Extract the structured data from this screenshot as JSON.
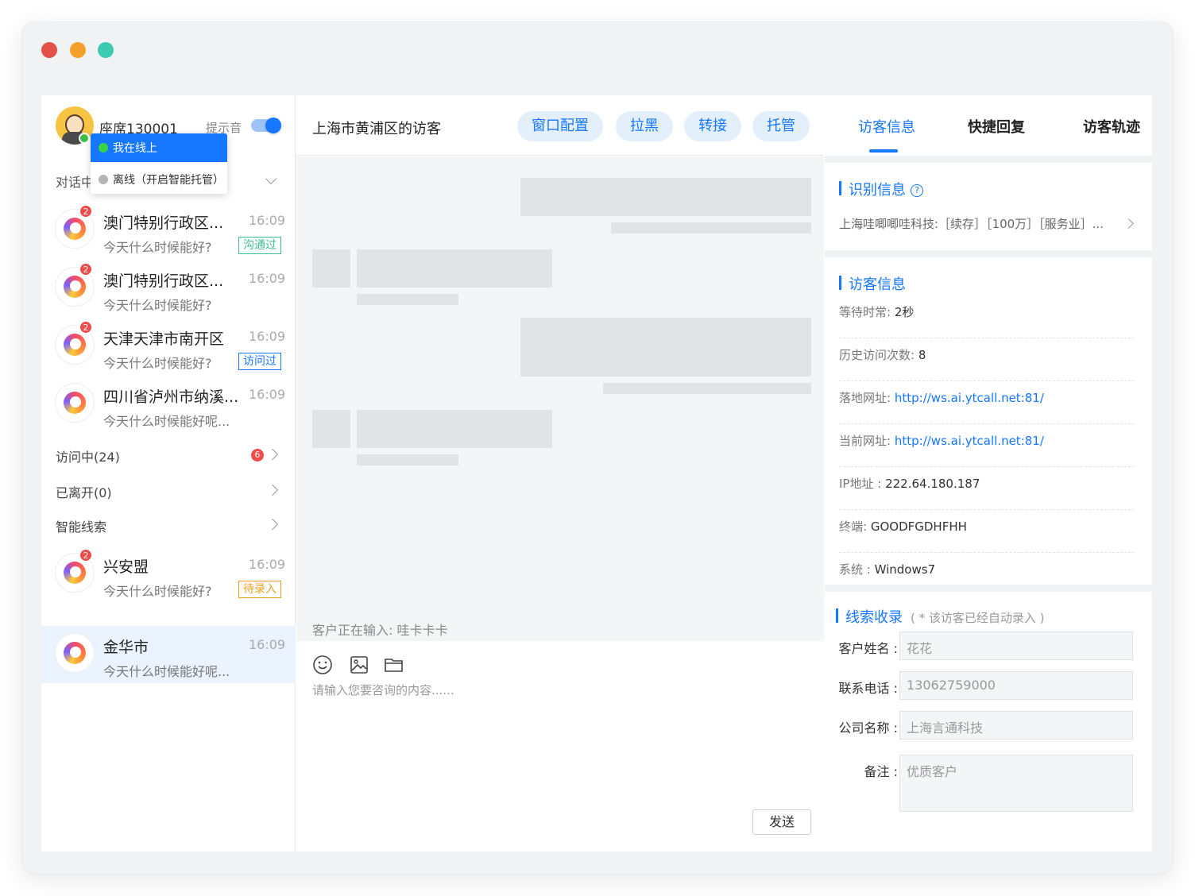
{
  "sidebar": {
    "seat": "座席130001",
    "hint_label": "提示音",
    "status_menu": {
      "online": "我在线上",
      "offline": "离线（开启智能托管）"
    },
    "conversing_label": "对话中",
    "conversations": [
      {
        "name": "澳门特别行政区...",
        "time": "16:09",
        "message": "今天什么时候能好?",
        "badge": "2",
        "tag": "沟通过"
      },
      {
        "name": "澳门特别行政区...",
        "time": "16:09",
        "message": "今天什么时候能好?",
        "badge": "2",
        "tag": ""
      },
      {
        "name": "天津天津市南开区",
        "time": "16:09",
        "message": "今天什么时候能好?",
        "badge": "2",
        "tag": "访问过"
      },
      {
        "name": "四川省泸州市纳溪...",
        "time": "16:09",
        "message": "今天什么时候能好呢...",
        "badge": "",
        "tag": ""
      }
    ],
    "sections": [
      {
        "label": "访问中(24)",
        "badge": "6"
      },
      {
        "label": "已离开(0)",
        "badge": ""
      },
      {
        "label": "智能线索",
        "badge": ""
      }
    ],
    "lead_conversations": [
      {
        "name": "兴安盟",
        "time": "16:09",
        "message": "今天什么时候能好?",
        "badge": "2",
        "tag": "待录入"
      },
      {
        "name": "金华市",
        "time": "16:09",
        "message": "今天什么时候能好呢...",
        "badge": "",
        "tag": ""
      }
    ]
  },
  "chat": {
    "title": "上海市黄浦区的访客",
    "actions": [
      "窗口配置",
      "拉黑",
      "转接",
      "托管"
    ],
    "typing_status": "客户正在输入: 哇卡卡卡",
    "input_placeholder": "请输入您要咨询的内容......",
    "send_label": "发送"
  },
  "right_panel": {
    "tabs": [
      "访客信息",
      "快捷回复",
      "访客轨迹"
    ],
    "identify": {
      "title": "识别信息",
      "line": "上海哇唧唧哇科技:［续存］［100万］［服务业］..."
    },
    "visitor": {
      "title": "访客信息",
      "rows": [
        {
          "key": "等待时常:",
          "value": "2秒",
          "link": false
        },
        {
          "key": "历史访问次数:",
          "value": "8",
          "link": false
        },
        {
          "key": "落地网址:",
          "value": "http://ws.ai.ytcall.net:81/",
          "link": true
        },
        {
          "key": "当前网址:",
          "value": "http://ws.ai.ytcall.net:81/",
          "link": true
        },
        {
          "key": "IP地址 :",
          "value": "222.64.180.187",
          "link": false
        },
        {
          "key": "终端:",
          "value": "GOODFGDHFHH",
          "link": false
        },
        {
          "key": "系统 :",
          "value": "Windows7",
          "link": false
        }
      ]
    },
    "lead": {
      "title": "线索收录",
      "note": "( * 该访客已经自动录入 )",
      "fields": [
        {
          "label": "客户姓名 :",
          "value": "花花"
        },
        {
          "label": "联系电话 :",
          "value": "13062759000"
        },
        {
          "label": "公司名称 :",
          "value": "上海言通科技"
        },
        {
          "label": "备注 :",
          "value": "优质客户"
        }
      ]
    }
  },
  "colors": {
    "accent": "#1677ff",
    "badge_red": "#ef4b4b",
    "online_green": "#3bc14a"
  }
}
